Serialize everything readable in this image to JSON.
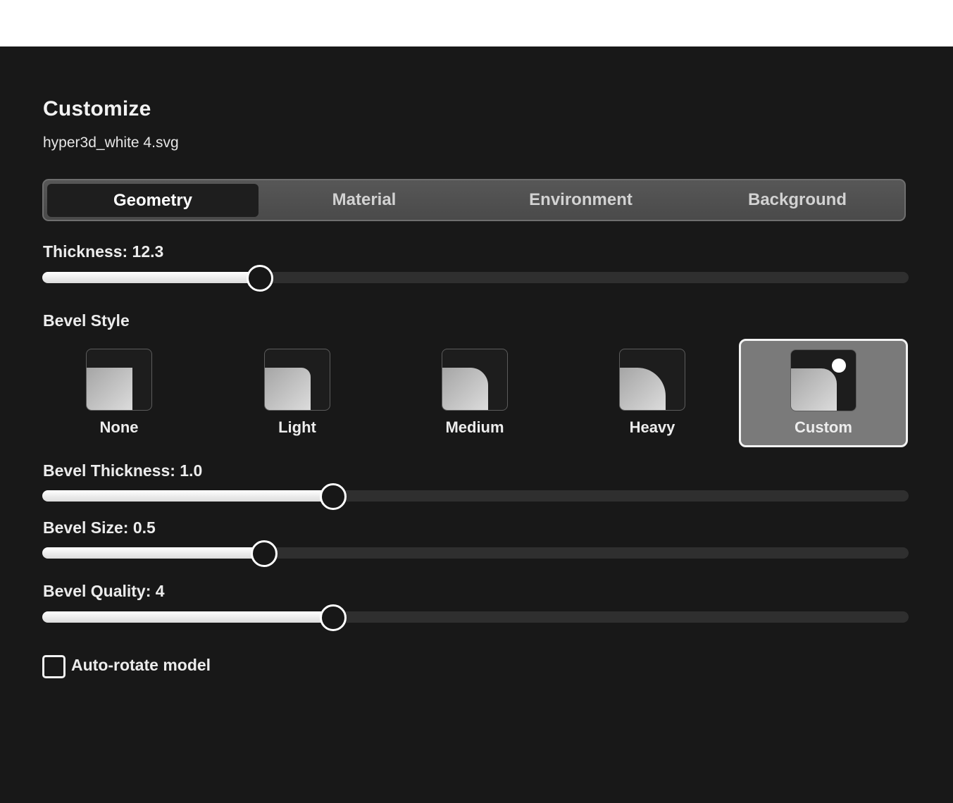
{
  "panel": {
    "title": "Customize",
    "filename": "hyper3d_white 4.svg"
  },
  "tabs": [
    {
      "label": "Geometry",
      "active": true
    },
    {
      "label": "Material",
      "active": false
    },
    {
      "label": "Environment",
      "active": false
    },
    {
      "label": "Background",
      "active": false
    }
  ],
  "thickness": {
    "label": "Thickness: 12.3",
    "value": 12.3,
    "fill_fraction": 0.25
  },
  "bevel_style": {
    "label": "Bevel Style",
    "options": [
      {
        "label": "None",
        "icon": "bevel-none-icon",
        "selected": false
      },
      {
        "label": "Light",
        "icon": "bevel-light-icon",
        "selected": false
      },
      {
        "label": "Medium",
        "icon": "bevel-medium-icon",
        "selected": false
      },
      {
        "label": "Heavy",
        "icon": "bevel-heavy-icon",
        "selected": false
      },
      {
        "label": "Custom",
        "icon": "bevel-custom-icon",
        "selected": true
      }
    ]
  },
  "bevel_thickness": {
    "label": "Bevel Thickness: 1.0",
    "value": 1.0,
    "fill_fraction": 0.335
  },
  "bevel_size": {
    "label": "Bevel Size: 0.5",
    "value": 0.5,
    "fill_fraction": 0.255
  },
  "bevel_quality": {
    "label": "Bevel Quality: 4",
    "value": 4,
    "fill_fraction": 0.335
  },
  "auto_rotate": {
    "label": "Auto-rotate model",
    "checked": false
  },
  "colors": {
    "panel_bg": "#181818",
    "accent": "#ffffff",
    "selected_option_bg": "#7a7a7a"
  }
}
